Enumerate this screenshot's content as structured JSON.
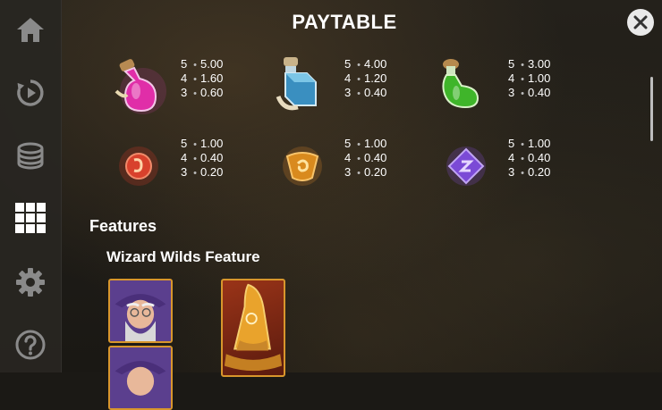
{
  "title": "PAYTABLE",
  "sidebar": {
    "items": [
      {
        "icon": "home-icon"
      },
      {
        "icon": "replay-icon"
      },
      {
        "icon": "coins-icon"
      },
      {
        "icon": "paytable-grid-icon"
      },
      {
        "icon": "settings-icon"
      },
      {
        "icon": "help-icon"
      }
    ]
  },
  "close_icon": "close-icon",
  "paytable": [
    {
      "symbol": "pink-potion",
      "rows": [
        {
          "count": "5",
          "value": "5.00"
        },
        {
          "count": "4",
          "value": "1.60"
        },
        {
          "count": "3",
          "value": "0.60"
        }
      ]
    },
    {
      "symbol": "blue-potion",
      "rows": [
        {
          "count": "5",
          "value": "4.00"
        },
        {
          "count": "4",
          "value": "1.20"
        },
        {
          "count": "3",
          "value": "0.40"
        }
      ]
    },
    {
      "symbol": "green-potion",
      "rows": [
        {
          "count": "5",
          "value": "3.00"
        },
        {
          "count": "4",
          "value": "1.00"
        },
        {
          "count": "3",
          "value": "0.40"
        }
      ]
    },
    {
      "symbol": "red-rune",
      "rows": [
        {
          "count": "5",
          "value": "1.00"
        },
        {
          "count": "4",
          "value": "0.40"
        },
        {
          "count": "3",
          "value": "0.20"
        }
      ]
    },
    {
      "symbol": "orange-rune",
      "rows": [
        {
          "count": "5",
          "value": "1.00"
        },
        {
          "count": "4",
          "value": "0.40"
        },
        {
          "count": "3",
          "value": "0.20"
        }
      ]
    },
    {
      "symbol": "purple-rune",
      "rows": [
        {
          "count": "5",
          "value": "1.00"
        },
        {
          "count": "4",
          "value": "0.40"
        },
        {
          "count": "3",
          "value": "0.20"
        }
      ]
    }
  ],
  "features": {
    "heading": "Features",
    "wizard_wilds_title": "Wizard Wilds Feature"
  },
  "colors": {
    "sidebar_bg": "#282622",
    "card_border": "#d8962c",
    "icon_gray": "#8a8a8a",
    "icon_active": "#ffffff"
  }
}
